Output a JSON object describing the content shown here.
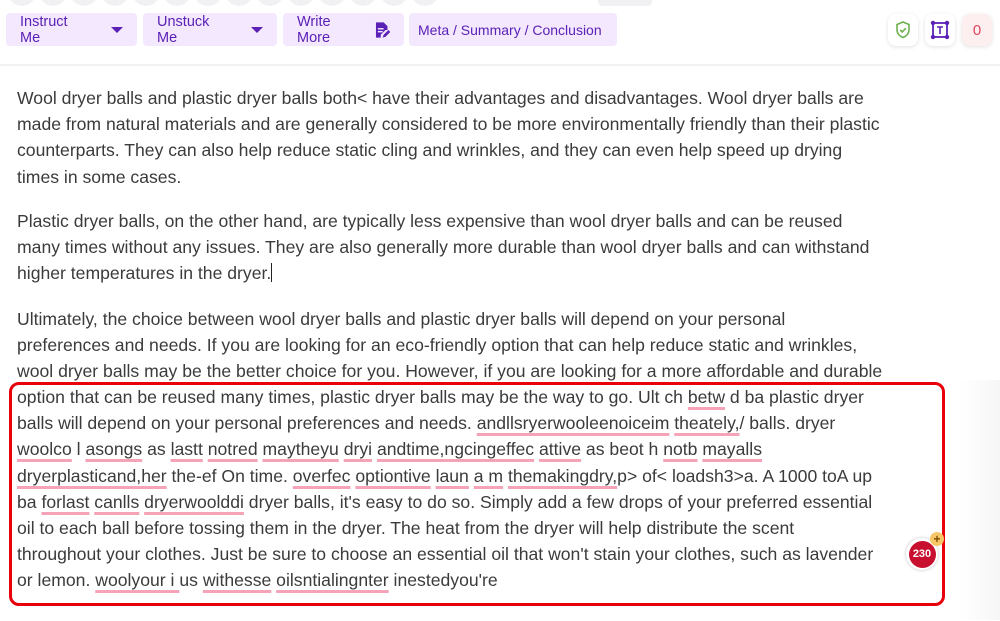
{
  "toolbar": {
    "instruct_label": "Instruct Me",
    "unstuck_label": "Unstuck Me",
    "write_more_label": "Write More",
    "meta_label": "Meta / Summary / Conclusion",
    "plagiarism_count": "0"
  },
  "colors": {
    "button_bg": "#f3e8fd",
    "button_text": "#5b21b6",
    "shield_green": "#6ab04c",
    "highlight_border": "#e8000b",
    "spell_underline": "#f5a3b6",
    "score_badge": "#c8102e"
  },
  "document": {
    "p1": [
      "Wool dryer balls and plastic dryer balls both< have their advantages and disadvantages. Wool dryer balls are",
      "made from natural materials and are generally considered to be more environmentally friendly than their plastic",
      "counterparts. They can also help reduce static cling and wrinkles, and they can even help speed up drying",
      "times in some cases."
    ],
    "p2": [
      "Plastic dryer balls, on the other hand, are typically less expensive than wool dryer balls and can be reused",
      "many times without any issues. They are also generally more durable than wool dryer balls and can withstand",
      "higher temperatures in the dryer."
    ],
    "p3": [
      "Ultimately, the choice between wool dryer balls and plastic dryer balls will depend on your personal",
      "preferences and needs. If you are looking for an eco-friendly option that can help reduce static and wrinkles,",
      "wool dryer balls may be the better choice for you. However, if you are looking for a more affordable and durable"
    ],
    "highlighted": {
      "l1a": "option that can be reused many times, plastic dryer balls may be the way to go. Ult ch ",
      "l1b": "betw",
      "l1c": " d ba plastic dryer",
      "l2a": "balls will depend on your personal preferences and needs. ",
      "l2b": "andllsryerwooleenoiceim",
      "l2c": " ",
      "l2d": "theately,",
      "l2e": "/ balls. dryer",
      "l3": [
        "woolco",
        " l ",
        "asongs",
        " as ",
        "lastt",
        " ",
        "notred",
        " ",
        "maytheyu",
        " ",
        "dryi",
        " ",
        "andtime,ngcingeffec",
        " ",
        "attive",
        " as beot h ",
        "notb",
        " ",
        "mayalls"
      ],
      "l4": [
        "dryerplasticand,her",
        " the-ef On time. ",
        "overfec",
        " ",
        "optiontive",
        " ",
        "laun",
        " ",
        "a m",
        " ",
        "themakingdry,",
        "p> of< loadsh3>a. A 1000 toA up"
      ],
      "l5": [
        "ba ",
        "forlast",
        " ",
        "canlls",
        " ",
        "dryerwoolddi",
        " dryer balls, it's easy to do so. Simply add a few drops of your preferred essential"
      ],
      "l6": "oil to each ball before tossing them in the dryer. The heat from the dryer will help distribute the scent",
      "l7": "throughout your clothes. Just be sure to choose an essential oil that won't stain your clothes, such as lavender",
      "l8": [
        "or lemon. ",
        "woolyour i ",
        "us ",
        "withesse",
        " ",
        "oilsntialingnter",
        " inestedyou're"
      ]
    },
    "score_value": "230",
    "score_plus": "+"
  }
}
